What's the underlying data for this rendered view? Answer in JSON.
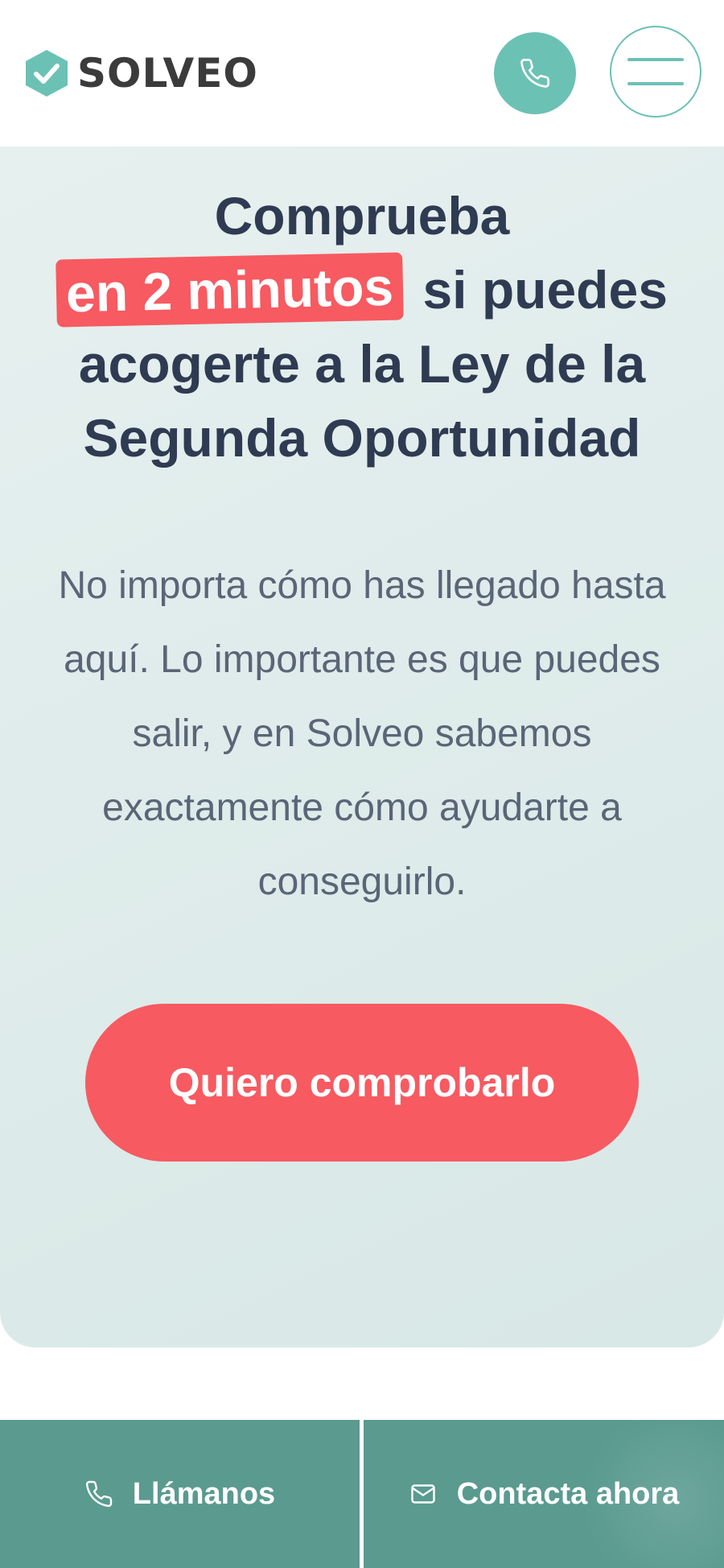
{
  "header": {
    "logo_text": "SOLVEO",
    "logo_icon": "check-shield-icon",
    "call_icon": "phone-icon",
    "menu_icon": "hamburger-menu-icon"
  },
  "hero": {
    "title_line1": "Comprueba",
    "title_highlight": "en 2 minutos",
    "title_line2_rest": "si puedes",
    "title_line3": "acogerte a la Ley de la",
    "title_line4": "Segunda Oportunidad",
    "description": "No importa cómo has llegado hasta aquí. Lo importante es que puedes salir, y en Solveo sabemos exactamente cómo ayudarte a conseguirlo.",
    "cta_label": "Quiero comprobarlo"
  },
  "bottom_bar": {
    "call_label": "Llámanos",
    "call_icon": "phone-icon",
    "contact_label": "Contacta ahora",
    "contact_icon": "mail-icon"
  },
  "colors": {
    "brand_teal": "#6cc1b5",
    "accent_red": "#f75a61",
    "bar_teal": "#5a9a8f",
    "text_dark": "#2f3b52"
  }
}
